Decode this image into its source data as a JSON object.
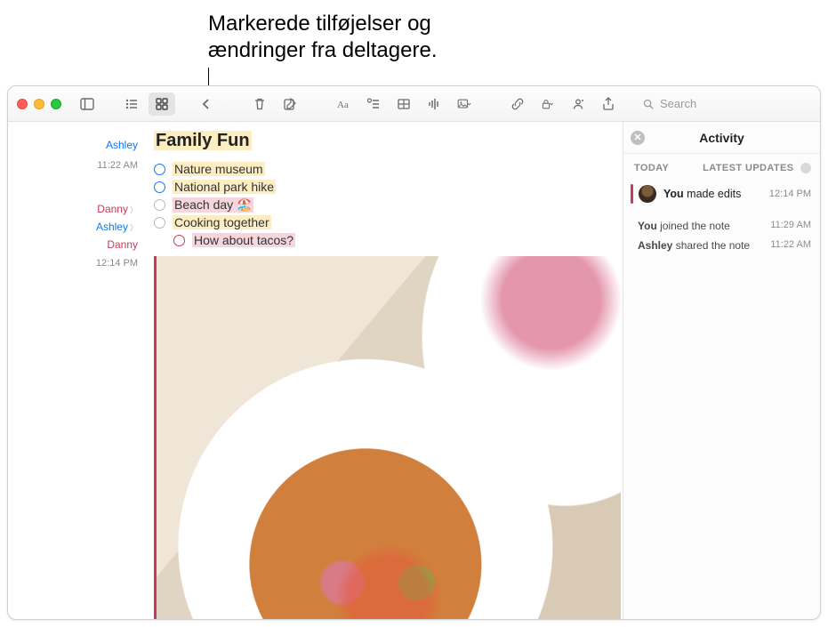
{
  "callout": {
    "line1": "Markerede tilføjelser og",
    "line2": "ændringer fra deltagere."
  },
  "search": {
    "placeholder": "Search"
  },
  "gutter": [
    {
      "name": "Ashley",
      "color": "blue",
      "time": "11:22 AM",
      "showChevron": false
    },
    {
      "name": "Danny",
      "color": "red",
      "time": "",
      "showChevron": true
    },
    {
      "name": "Ashley",
      "color": "blue",
      "time": "",
      "showChevron": true
    },
    {
      "name": "Danny",
      "color": "red",
      "time": "12:14 PM",
      "showChevron": false
    }
  ],
  "note": {
    "title": "Family Fun",
    "items": [
      {
        "circle": "blue",
        "text": "Nature museum",
        "highlight": "yellow",
        "indent": false
      },
      {
        "circle": "blue",
        "text": "National park hike",
        "highlight": "yellow",
        "indent": false
      },
      {
        "circle": "grey",
        "text": "Beach day 🏖️",
        "highlight": "pink",
        "indent": false
      },
      {
        "circle": "grey",
        "text": "Cooking together",
        "highlight": "yellow",
        "indent": false
      },
      {
        "circle": "red",
        "text": "How about tacos?",
        "highlight": "pink",
        "indent": true
      }
    ]
  },
  "activity": {
    "title": "Activity",
    "today_label": "TODAY",
    "latest_label": "LATEST UPDATES",
    "featured": {
      "who": "You",
      "action": "made edits",
      "time": "12:14 PM"
    },
    "lines": [
      {
        "who": "You",
        "action": "joined the note",
        "time": "11:29 AM"
      },
      {
        "who": "Ashley",
        "action": "shared the note",
        "time": "11:22 AM"
      }
    ]
  }
}
